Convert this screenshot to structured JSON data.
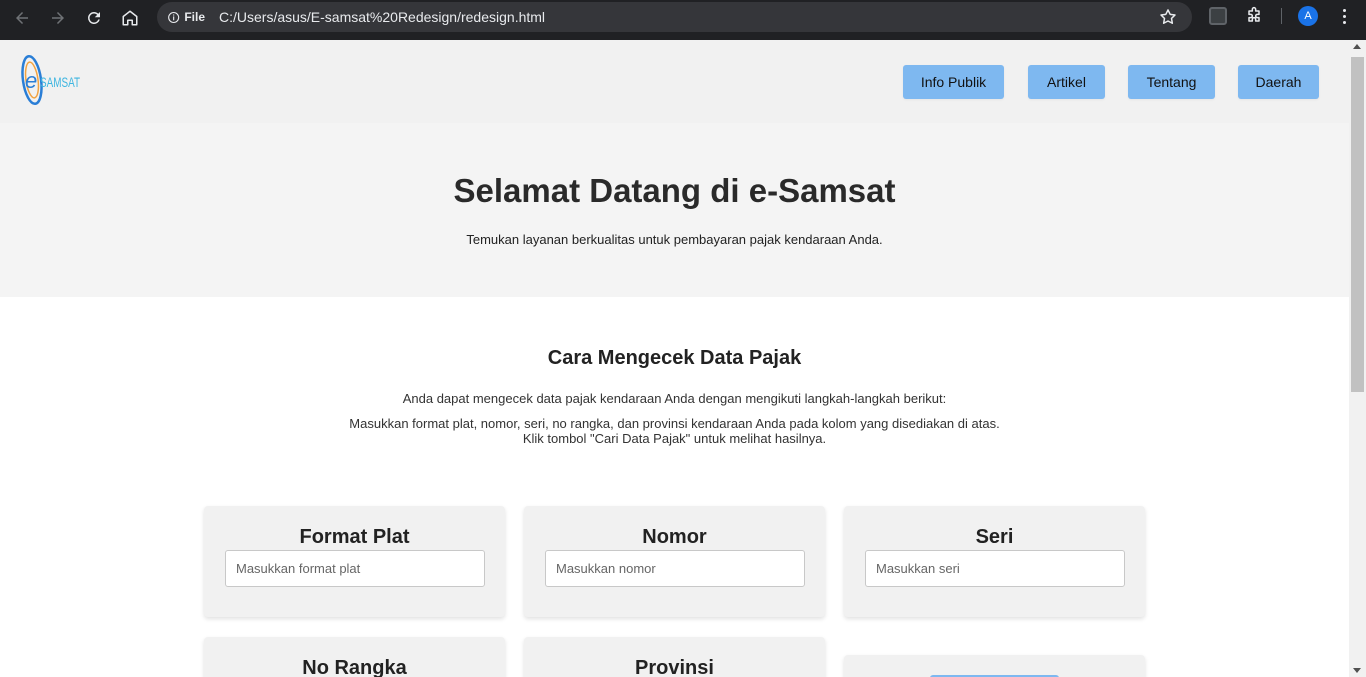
{
  "browser": {
    "chip_label": "File",
    "url": "C:/Users/asus/E-samsat%20Redesign/redesign.html",
    "avatar_letter": "A"
  },
  "header": {
    "logo_letter": "e",
    "logo_text": "SAMSAT",
    "nav": [
      {
        "label": "Info Publik"
      },
      {
        "label": "Artikel"
      },
      {
        "label": "Tentang"
      },
      {
        "label": "Daerah"
      }
    ]
  },
  "hero": {
    "title": "Selamat Datang di e-Samsat",
    "subtitle": "Temukan layanan berkualitas untuk pembayaran pajak kendaraan Anda."
  },
  "guide": {
    "title": "Cara Mengecek Data Pajak",
    "intro": "Anda dapat mengecek data pajak kendaraan Anda dengan mengikuti langkah-langkah berikut:",
    "step1": "Masukkan format plat, nomor, seri, no rangka, dan provinsi kendaraan Anda pada kolom yang disediakan di atas.",
    "step2": "Klik tombol \"Cari Data Pajak\" untuk melihat hasilnya."
  },
  "form": {
    "fields": [
      {
        "label": "Format Plat",
        "placeholder": "Masukkan format plat"
      },
      {
        "label": "Nomor",
        "placeholder": "Masukkan nomor"
      },
      {
        "label": "Seri",
        "placeholder": "Masukkan seri"
      },
      {
        "label": "No Rangka"
      },
      {
        "label": "Provinsi"
      }
    ]
  },
  "colors": {
    "nav_button": "#7eb8f0",
    "header_bg": "#f1f1f1",
    "chrome_bg": "#202124"
  }
}
